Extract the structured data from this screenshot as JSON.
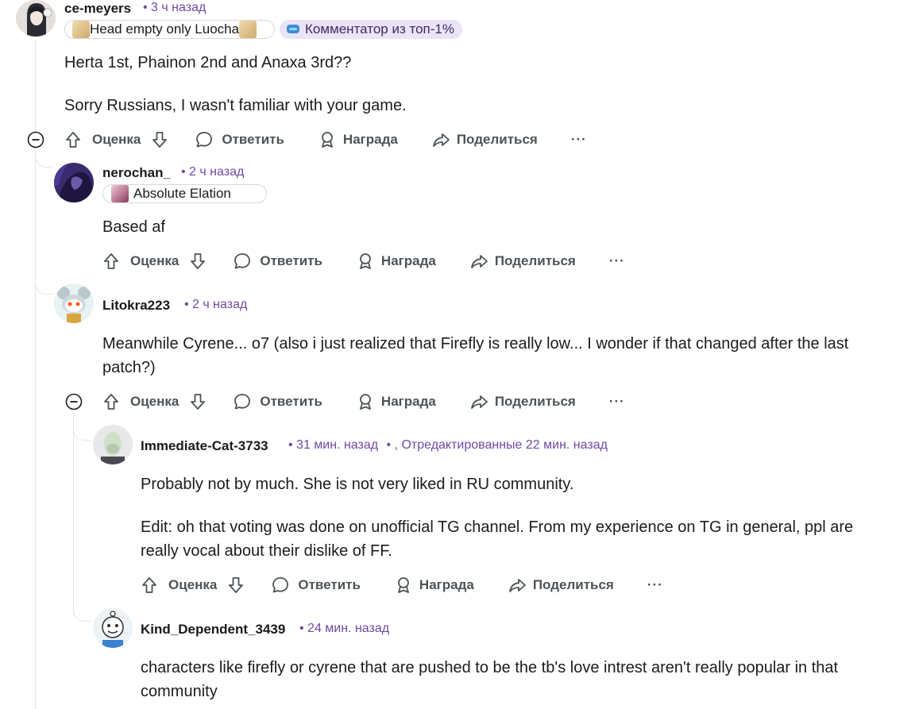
{
  "actions": {
    "vote": "Оценка",
    "reply": "Ответить",
    "award": "Награда",
    "share": "Поделиться",
    "more": "···"
  },
  "comments": [
    {
      "username": "ce-meyers",
      "time": "• 3 ч назад",
      "flair": "Head empty only Luocha",
      "badge": "Комментатор из топ-1%",
      "paragraphs": [
        "Herta 1st, Phainon 2nd and Anaxa 3rd??",
        "Sorry Russians, I wasn't familiar with your game."
      ]
    },
    {
      "username": "nerochan_",
      "time": "• 2 ч назад",
      "flair": "Absolute Elation",
      "paragraphs": [
        "Based af"
      ]
    },
    {
      "username": "Litokra223",
      "time": "• 2 ч назад",
      "paragraphs": [
        "Meanwhile Cyrene... o7 (also i just realized that Firefly is really low... I wonder if that changed after the last patch?)"
      ]
    },
    {
      "username": "Immediate-Cat-3733",
      "time": "• 31 мин. назад",
      "edited": "• , Отредактированные 22 мин. назад",
      "paragraphs": [
        "Probably not by much. She is not very liked in RU community.",
        "Edit: oh that voting was done on unofficial TG channel.  From my experience on TG in general, ppl are really vocal about their dislike of FF."
      ]
    },
    {
      "username": "Kind_Dependent_3439",
      "time": "• 24 мин. назад",
      "paragraphs": [
        "characters like firefly or cyrene that are pushed to be the tb's love intrest aren't really popular in that community"
      ]
    }
  ]
}
